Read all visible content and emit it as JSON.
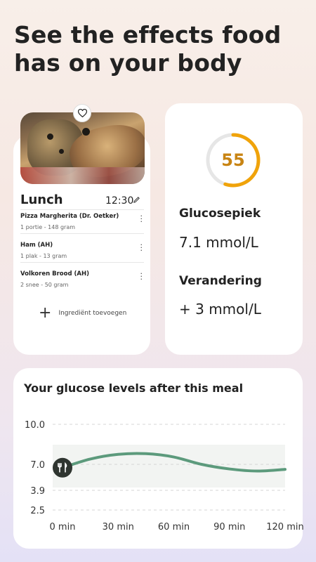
{
  "headline": "See the effects food has on your body",
  "meal": {
    "title": "Lunch",
    "time": "12:30",
    "ingredients": [
      {
        "name": "Pizza Margherita (Dr. Oetker)",
        "qty": "1 portie - 148 gram"
      },
      {
        "name": "Ham (AH)",
        "qty": "1 plak - 13 gram"
      },
      {
        "name": "Volkoren Brood (AH)",
        "qty": "2 snee - 50 gram"
      }
    ],
    "add_label": "Ingrediënt toevoegen"
  },
  "glucose": {
    "score": "55",
    "score_fraction": 0.55,
    "score_color": "#f0a30a",
    "peak_label": "Glucosepiek",
    "peak_value": "7.1 mmol/L",
    "change_label": "Verandering",
    "change_value": "+ 3 mmol/L"
  },
  "chart": {
    "title": "Your glucose levels after this meal"
  },
  "chart_data": {
    "type": "line",
    "title": "Your glucose levels after this meal",
    "x_ticks": [
      "0 min",
      "30 min",
      "60 min",
      "90 min",
      "120 min"
    ],
    "y_ticks": [
      "10.0",
      "7.0",
      "3.9",
      "2.5"
    ],
    "ylim": [
      2.5,
      10.0
    ],
    "xlim": [
      0,
      120
    ],
    "target_range": [
      3.9,
      7.8
    ],
    "series": [
      {
        "x": [
          0,
          15,
          30,
          45,
          60,
          75,
          90,
          105,
          120
        ],
        "y": [
          6.6,
          7.4,
          7.75,
          7.8,
          7.55,
          7.0,
          6.45,
          6.2,
          6.4
        ]
      }
    ],
    "line_color": "#5c9a7c",
    "marker": "fork-knife-icon"
  }
}
